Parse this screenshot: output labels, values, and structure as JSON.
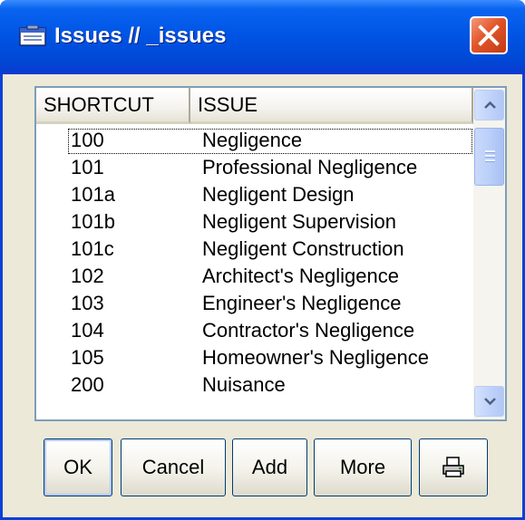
{
  "window": {
    "title": "Issues // _issues",
    "title_icon": "database-icon",
    "close_icon": "close-icon"
  },
  "columns": [
    "SHORTCUT",
    "ISSUE"
  ],
  "rows": [
    {
      "shortcut": "100",
      "issue": "Negligence"
    },
    {
      "shortcut": "101",
      "issue": "Professional Negligence"
    },
    {
      "shortcut": "101a",
      "issue": "Negligent Design"
    },
    {
      "shortcut": "101b",
      "issue": "Negligent Supervision"
    },
    {
      "shortcut": "101c",
      "issue": "Negligent Construction"
    },
    {
      "shortcut": "102",
      "issue": "Architect's Negligence"
    },
    {
      "shortcut": "103",
      "issue": "Engineer's Negligence"
    },
    {
      "shortcut": "104",
      "issue": "Contractor's Negligence"
    },
    {
      "shortcut": "105",
      "issue": "Homeowner's Negligence"
    },
    {
      "shortcut": "200",
      "issue": "Nuisance"
    }
  ],
  "focused_row": 0,
  "buttons": {
    "ok": "OK",
    "cancel": "Cancel",
    "add": "Add",
    "more": "More",
    "print_icon": "printer-icon"
  },
  "colors": {
    "title_bar": "#0055e5",
    "close_button": "#e2552a",
    "dialog_bg": "#ece9d8",
    "list_border": "#7f9db9"
  }
}
